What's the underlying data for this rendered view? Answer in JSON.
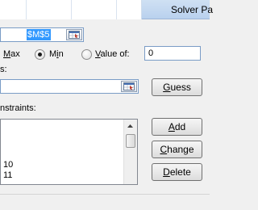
{
  "window": {
    "title": "Solver Pa"
  },
  "objective": {
    "value": "$M$5",
    "range_icon": "range-select-icon"
  },
  "to_options": {
    "max_label_rest": "ax",
    "max_label_u": "M",
    "min_label_u": "i",
    "min_label_pre": "M",
    "min_label_post": "n",
    "value_of_u": "V",
    "value_of_rest": "alue of:",
    "selected": "Min",
    "value_of_input": "0"
  },
  "changing_cells": {
    "label_fragment": "s:",
    "value": "",
    "range_icon": "range-select-icon"
  },
  "buttons": {
    "guess": "Guess",
    "guess_u": "G",
    "guess_rest": "uess",
    "add": "Add",
    "add_u": "A",
    "add_rest": "dd",
    "change": "Change",
    "change_u": "C",
    "change_rest": "hange",
    "delete": "Delete",
    "delete_u": "D",
    "delete_rest": "elete"
  },
  "constraints": {
    "label_fragment": "nstraints:",
    "items": [
      "10",
      "11"
    ]
  },
  "colors": {
    "title_bar": "#c4d8f0",
    "selection": "#3399ff",
    "field_border": "#7a9cc6"
  }
}
